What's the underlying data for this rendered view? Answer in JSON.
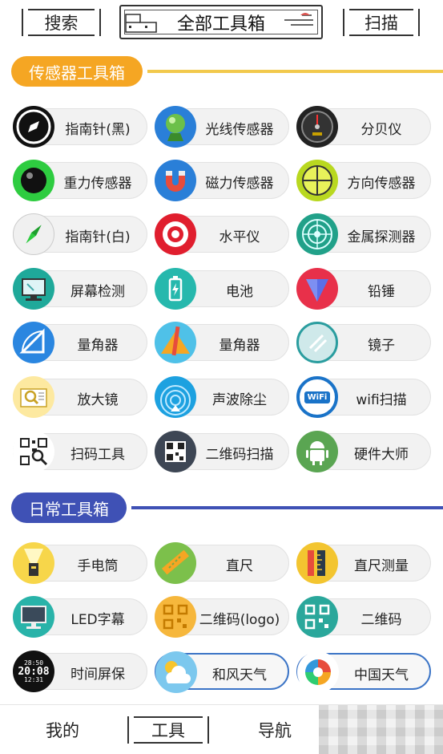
{
  "header": {
    "search_label": "搜索",
    "title": "全部工具箱",
    "scan_label": "扫描"
  },
  "sections": {
    "sensor": {
      "title": "传感器工具箱",
      "color": "#f5a623",
      "line_color": "#f2c94c"
    },
    "daily": {
      "title": "日常工具箱",
      "color": "#3f51b5",
      "line_color": "#3f51b5"
    }
  },
  "sensor_tools": [
    {
      "label": "指南针(黑)",
      "icon": "compass-black-icon"
    },
    {
      "label": "光线传感器",
      "icon": "light-sensor-icon"
    },
    {
      "label": "分贝仪",
      "icon": "decibel-meter-icon"
    },
    {
      "label": "重力传感器",
      "icon": "gravity-sensor-icon"
    },
    {
      "label": "磁力传感器",
      "icon": "magnet-icon"
    },
    {
      "label": "方向传感器",
      "icon": "orientation-icon"
    },
    {
      "label": "指南针(白)",
      "icon": "compass-white-icon"
    },
    {
      "label": "水平仪",
      "icon": "level-target-icon"
    },
    {
      "label": "金属探测器",
      "icon": "radar-icon"
    },
    {
      "label": "屏幕检测",
      "icon": "screen-test-icon"
    },
    {
      "label": "电池",
      "icon": "battery-icon"
    },
    {
      "label": "铅锤",
      "icon": "plumb-bob-icon"
    },
    {
      "label": "量角器",
      "icon": "protractor-icon"
    },
    {
      "label": "量角器",
      "icon": "protractor-pencil-icon"
    },
    {
      "label": "镜子",
      "icon": "mirror-icon"
    },
    {
      "label": "放大镜",
      "icon": "magnifier-icon"
    },
    {
      "label": "声波除尘",
      "icon": "sound-wave-icon"
    },
    {
      "label": "wifi扫描",
      "icon": "wifi-icon"
    },
    {
      "label": "扫码工具",
      "icon": "qr-scan-icon"
    },
    {
      "label": "二维码扫描",
      "icon": "qr-code-icon"
    },
    {
      "label": "硬件大师",
      "icon": "android-icon"
    }
  ],
  "daily_tools": [
    {
      "label": "手电筒",
      "icon": "flashlight-icon"
    },
    {
      "label": "直尺",
      "icon": "ruler-icon"
    },
    {
      "label": "直尺测量",
      "icon": "ruler-measure-icon"
    },
    {
      "label": "LED字幕",
      "icon": "led-monitor-icon"
    },
    {
      "label": "二维码(logo)",
      "icon": "qr-logo-icon"
    },
    {
      "label": "二维码",
      "icon": "qr-icon"
    },
    {
      "label": "时间屏保",
      "icon": "clock-icon"
    },
    {
      "label": "和风天气",
      "icon": "weather-icon"
    },
    {
      "label": "中国天气",
      "icon": "china-weather-icon"
    }
  ],
  "clock_text": {
    "line1": "28:50",
    "line2": "20:08",
    "line3": "12:31"
  },
  "bottom_nav": {
    "mine": "我的",
    "tools": "工具",
    "nav": "导航"
  }
}
